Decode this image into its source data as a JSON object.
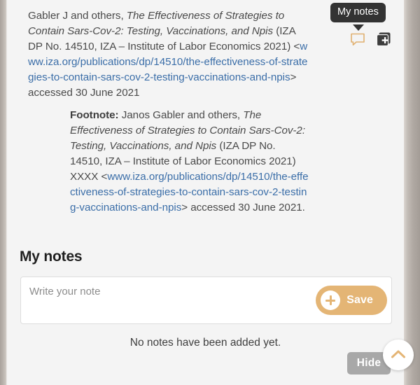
{
  "colors": {
    "page_background": "#f4f4f4",
    "frame_gray": "#b5aea8",
    "link_blue": "#3b6ea8",
    "accent_tan": "#e4b575",
    "tooltip_dark": "#333333",
    "hide_gray": "#a8a8a8",
    "body_text": "#4a4a4a"
  },
  "citation": {
    "authors": "Gabler J and others, ",
    "title_italic": "The Effectiveness of Strategies to Contain Sars-Cov-2: Testing, Vaccinations, and Npis",
    "publication": " (IZA DP No. 14510, IZA – Institute of Labor Economics 2021) <",
    "url": "www.iza.org/publications/dp/14510/the-effectiveness-of-strategies-to-contain-sars-cov-2-testing-vaccinations-and-npis",
    "accessed": "> accessed 30 June 2021"
  },
  "footnote": {
    "label": "Footnote:",
    "authors": " Janos Gabler and others, ",
    "title_italic": "The Effectiveness of Strategies to Contain Sars-Cov-2: Testing, Vaccinations, and Npis",
    "publication": " (IZA DP No. 14510, IZA – Institute of Labor Economics 2021) XXXX <",
    "url": "www.iza.org/publications/dp/14510/the-effectiveness-of-strategies-to-contain-sars-cov-2-testing-vaccinations-and-npis",
    "accessed": "> accessed 30 June 2021."
  },
  "note_tools": {
    "tooltip_label": "My notes",
    "notes_icon_name": "speech-bubble-icon",
    "add_icon_name": "add-to-collection-icon"
  },
  "notes_section": {
    "heading": "My notes",
    "input_placeholder": "Write your note",
    "input_value": "",
    "save_label": "Save",
    "empty_message": "No notes have been added yet."
  },
  "footer": {
    "hide_label": "Hide",
    "scroll_top_icon": "chevron-up-icon"
  }
}
